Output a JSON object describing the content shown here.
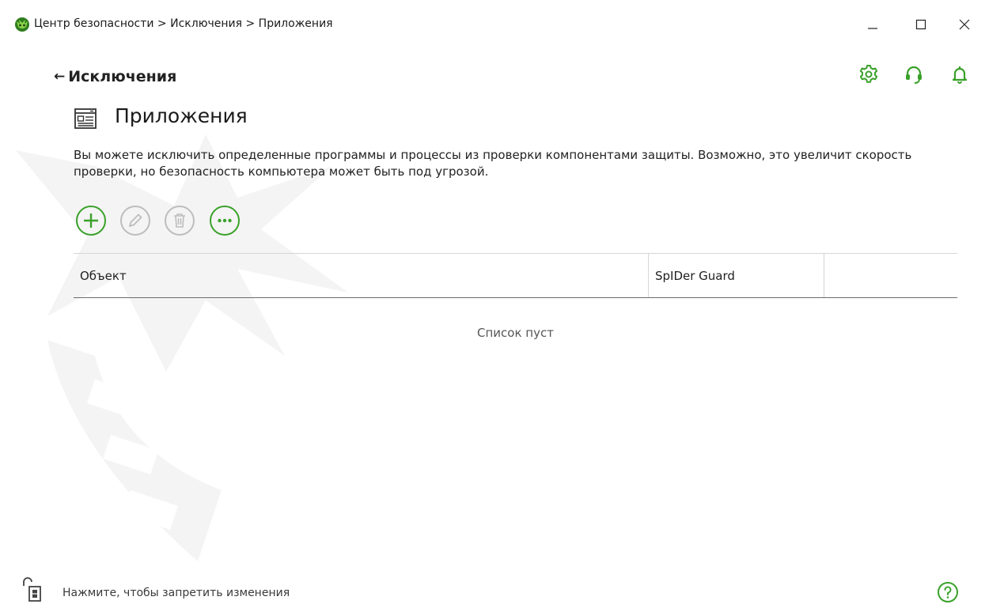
{
  "window": {
    "title": "Центр безопасности > Исключения > Приложения",
    "controls": {
      "minimize_icon": "minimize-icon",
      "maximize_icon": "maximize-icon",
      "close_icon": "close-icon"
    }
  },
  "header": {
    "back_label": "Исключения",
    "icons": [
      "gear-icon",
      "headset-support-icon",
      "bell-icon"
    ]
  },
  "page": {
    "title": "Приложения",
    "description": "Вы можете исключить определенные программы и процессы из проверки компонентами защиты. Возможно, это увеличит скорость проверки, но безопасность компьютера может быть под угрозой."
  },
  "toolbar": {
    "buttons": [
      {
        "name": "add",
        "icon": "plus-icon",
        "enabled": true
      },
      {
        "name": "edit",
        "icon": "pencil-icon",
        "enabled": false
      },
      {
        "name": "delete",
        "icon": "trash-icon",
        "enabled": false
      },
      {
        "name": "more",
        "icon": "ellipsis-icon",
        "enabled": true
      }
    ]
  },
  "table": {
    "columns": [
      "Объект",
      "SpIDer Guard",
      ""
    ],
    "rows": [],
    "empty_text": "Список пуст"
  },
  "footer": {
    "lock_text": "Нажмите, чтобы запретить изменения",
    "help_icon": "help-icon"
  },
  "colors": {
    "accent": "#3aa12a",
    "disabled": "#bdbdbd",
    "text": "#1f1f1f",
    "watermark": "#f4f4f4"
  }
}
